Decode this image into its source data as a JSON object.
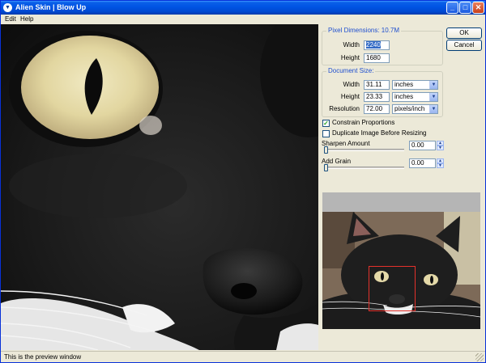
{
  "window": {
    "app_name": "Alien Skin",
    "separator": "|",
    "tool_name": "Blow Up"
  },
  "menu": [
    "Edit",
    "Help"
  ],
  "pixel_dimensions": {
    "title": "Pixel Dimensions: 10.7M",
    "width_label": "Width",
    "width_value": "2240",
    "height_label": "Height",
    "height_value": "1680"
  },
  "document_size": {
    "title": "Document Size:",
    "width_label": "Width",
    "width_value": "31.11",
    "width_unit": "inches",
    "height_label": "Height",
    "height_value": "23.33",
    "height_unit": "inches",
    "resolution_label": "Resolution",
    "resolution_value": "72.00",
    "resolution_unit": "pixels/inch"
  },
  "options": {
    "constrain_label": "Constrain Proportions",
    "constrain_checked": true,
    "duplicate_label": "Duplicate Image Before Resizing",
    "duplicate_checked": false
  },
  "sharpen": {
    "label": "Sharpen Amount",
    "value": "0.00",
    "level": 0
  },
  "grain": {
    "label": "Add Grain",
    "value": "0.00",
    "level": 0
  },
  "buttons": {
    "ok": "OK",
    "cancel": "Cancel"
  },
  "status": "This is the preview window",
  "colors": {
    "title_bar": "#0054e3",
    "group_title": "#1f4fcf",
    "crop_rect": "#e4312b"
  }
}
